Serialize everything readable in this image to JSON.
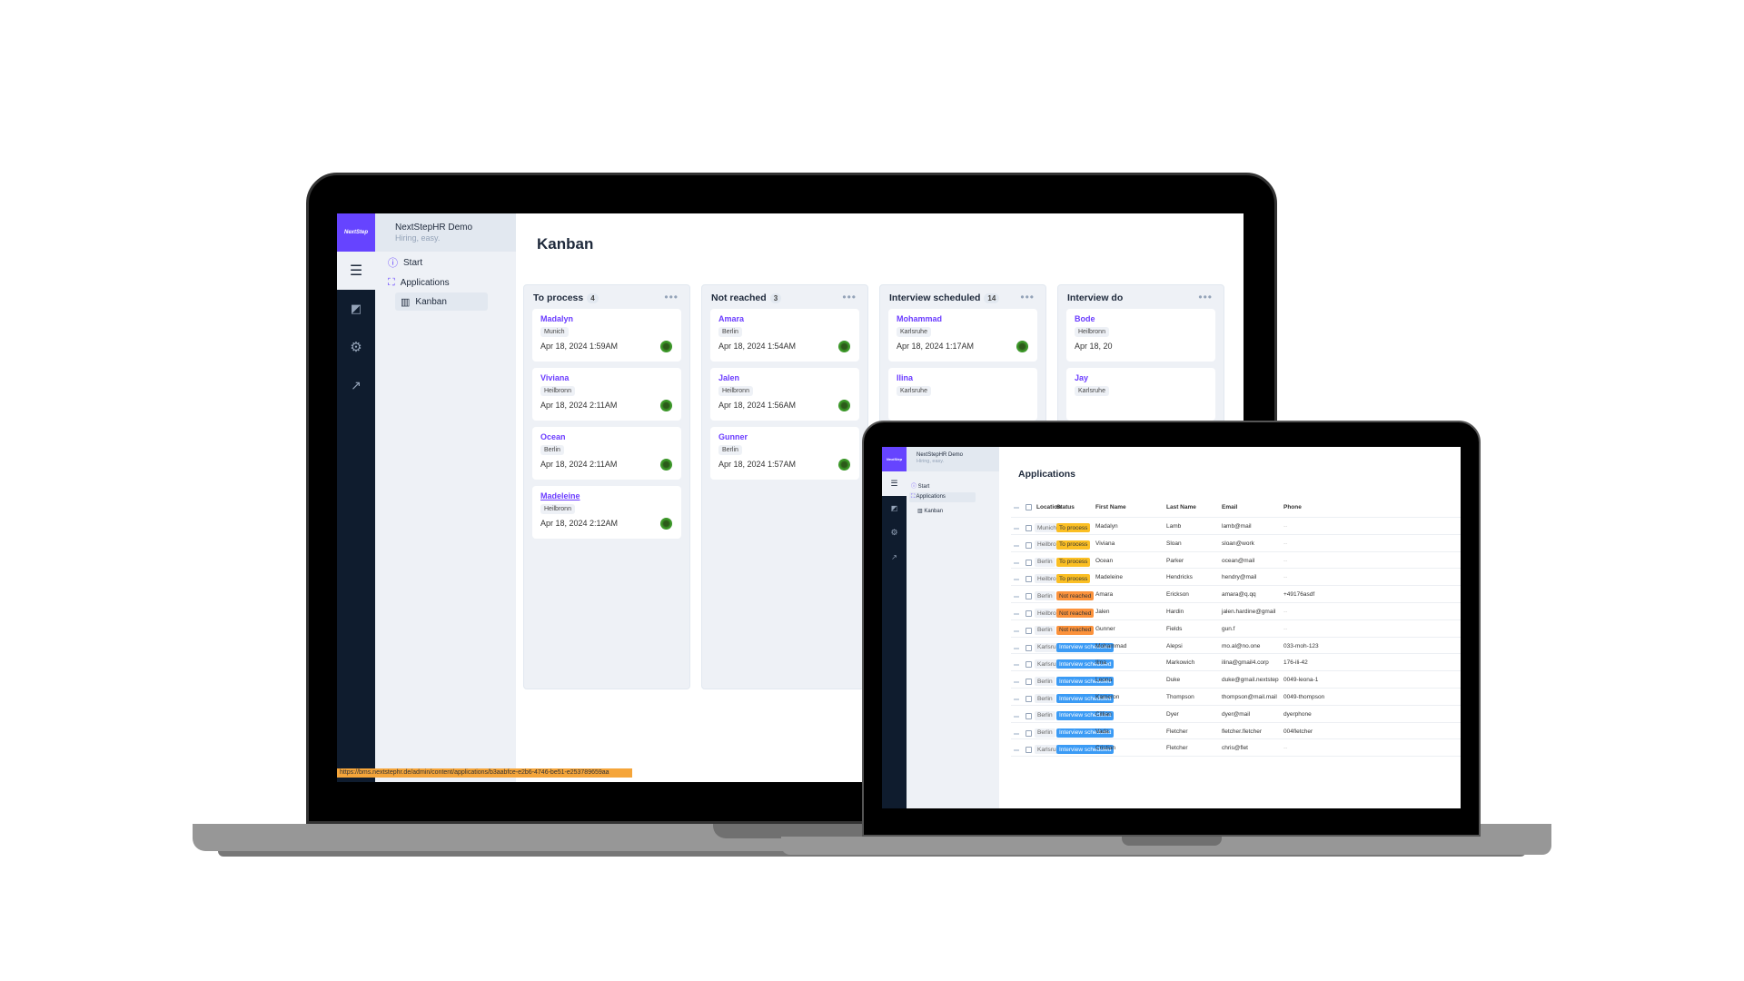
{
  "laptop": {
    "brand_logo": "NextStep",
    "app_title": "NextStepHR Demo",
    "app_subtitle": "Hiring, easy.",
    "nav": [
      {
        "label": "Start",
        "icon": "info-icon"
      },
      {
        "label": "Applications",
        "icon": "user-scan-icon"
      },
      {
        "label": "Kanban",
        "icon": "kanban-icon",
        "active": true
      }
    ],
    "rail_icons": [
      "database-icon",
      "chart-icon",
      "gear-icon",
      "arrow-up-right-icon"
    ],
    "page_title": "Kanban",
    "columns": [
      {
        "title": "To process",
        "count": "4",
        "cards": [
          {
            "name": "Madalyn",
            "location": "Munich",
            "date": "Apr 18, 2024 1:59AM"
          },
          {
            "name": "Viviana",
            "location": "Heilbronn",
            "date": "Apr 18, 2024 2:11AM"
          },
          {
            "name": "Ocean",
            "location": "Berlin",
            "date": "Apr 18, 2024 2:11AM"
          },
          {
            "name": "Madeleine",
            "location": "Heilbronn",
            "date": "Apr 18, 2024 2:12AM",
            "hovered": true
          }
        ]
      },
      {
        "title": "Not reached",
        "count": "3",
        "cards": [
          {
            "name": "Amara",
            "location": "Berlin",
            "date": "Apr 18, 2024 1:54AM"
          },
          {
            "name": "Jalen",
            "location": "Heilbronn",
            "date": "Apr 18, 2024 1:56AM"
          },
          {
            "name": "Gunner",
            "location": "Berlin",
            "date": "Apr 18, 2024 1:57AM"
          }
        ]
      },
      {
        "title": "Interview scheduled",
        "count": "14",
        "cards": [
          {
            "name": "Mohammad",
            "location": "Karlsruhe",
            "date": "Apr 18, 2024 1:17AM"
          },
          {
            "name": "Ilina",
            "location": "Karlsruhe",
            "date": ""
          }
        ]
      },
      {
        "title": "Interview do",
        "count": "",
        "cards": [
          {
            "name": "Bode",
            "location": "Heilbronn",
            "date": "Apr 18, 20"
          },
          {
            "name": "Jay",
            "location": "Karlsruhe",
            "date": ""
          }
        ]
      }
    ],
    "status_url": "https://bms.nextstephr.de/admin/content/applications/b3aabfce-e2b6-4746-be51-e253789659aa"
  },
  "tablet": {
    "brand_logo": "NextStep",
    "app_title": "NextStepHR Demo",
    "app_subtitle": "Hiring, easy.",
    "nav": [
      {
        "label": "Start"
      },
      {
        "label": "Applications",
        "active": true
      },
      {
        "label": "Kanban"
      }
    ],
    "page_title": "Applications",
    "columns": [
      "Location",
      "Status",
      "First Name",
      "Last Name",
      "Email",
      "Phone"
    ],
    "status_colors": {
      "To process": "#fbbf24",
      "Not reached": "#fb923c",
      "Interview scheduled": "#3b9bf5"
    },
    "rows": [
      {
        "location": "Munich",
        "status": "To process",
        "first": "Madalyn",
        "last": "Lamb",
        "email": "lamb@mail",
        "phone": "--"
      },
      {
        "location": "Heilbronn",
        "status": "To process",
        "first": "Viviana",
        "last": "Sloan",
        "email": "sloan@work",
        "phone": "--"
      },
      {
        "location": "Berlin",
        "status": "To process",
        "first": "Ocean",
        "last": "Parker",
        "email": "ocean@mail",
        "phone": "--"
      },
      {
        "location": "Heilbronn",
        "status": "To process",
        "first": "Madeleine",
        "last": "Hendricks",
        "email": "hendry@mail",
        "phone": "--"
      },
      {
        "location": "Berlin",
        "status": "Not reached",
        "first": "Amara",
        "last": "Erickson",
        "email": "amara@q.qq",
        "phone": "+49176asdf"
      },
      {
        "location": "Heilbronn",
        "status": "Not reached",
        "first": "Jalen",
        "last": "Hardin",
        "email": "jalen.hardine@gmail",
        "phone": "--"
      },
      {
        "location": "Berlin",
        "status": "Not reached",
        "first": "Gunner",
        "last": "Fields",
        "email": "gun.f",
        "phone": "--"
      },
      {
        "location": "Karlsruhe",
        "status": "Interview scheduled",
        "first": "Mohammad",
        "last": "Alepsi",
        "email": "mo.al@no.one",
        "phone": "033-moh-123"
      },
      {
        "location": "Karlsruhe",
        "status": "Interview scheduled",
        "first": "Ilina",
        "last": "Markowich",
        "email": "ilina@gmail4.corp",
        "phone": "176-ili-42"
      },
      {
        "location": "Berlin",
        "status": "Interview scheduled",
        "first": "Leona",
        "last": "Duke",
        "email": "duke@gmail.nextstep",
        "phone": "0049-leona-1"
      },
      {
        "location": "Berlin",
        "status": "Interview scheduled",
        "first": "Kameron",
        "last": "Thompson",
        "email": "thompson@mail.mail",
        "phone": "0049-thompson"
      },
      {
        "location": "Berlin",
        "status": "Interview scheduled",
        "first": "Cillian",
        "last": "Dyer",
        "email": "dyer@mail",
        "phone": "dyerphone"
      },
      {
        "location": "Berlin",
        "status": "Interview scheduled",
        "first": "Vada",
        "last": "Fletcher",
        "email": "fletcher.fletcher",
        "phone": "004fletcher"
      },
      {
        "location": "Karlsruhe",
        "status": "Interview scheduled",
        "first": "Cristian",
        "last": "Fletcher",
        "email": "chris@flet",
        "phone": "--"
      }
    ]
  },
  "colors": {
    "brand": "#6644ff",
    "sidebar": "#0f1c2e",
    "accent_text": "#6b3cff",
    "url_bar": "#f5a53a"
  }
}
